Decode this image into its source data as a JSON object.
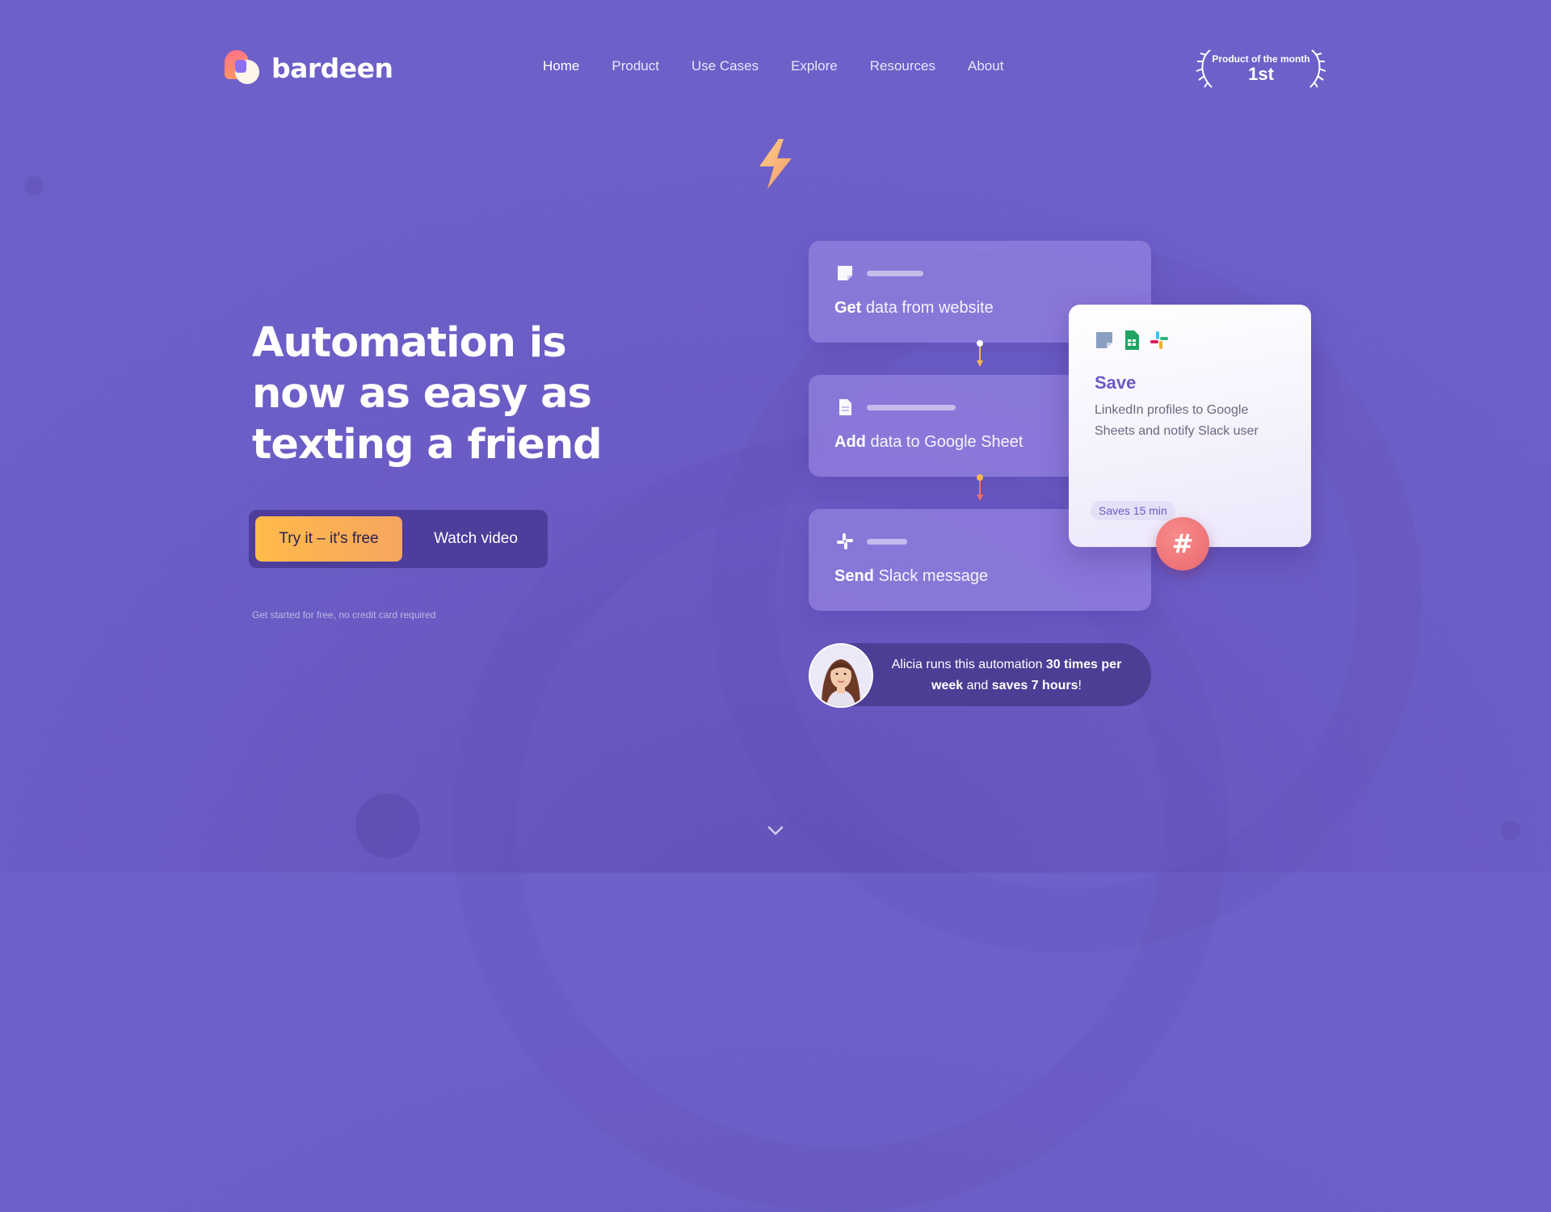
{
  "brand": {
    "name": "bardeen"
  },
  "nav": {
    "items": [
      {
        "label": "Home",
        "active": true
      },
      {
        "label": "Product"
      },
      {
        "label": "Use Cases"
      },
      {
        "label": "Explore"
      },
      {
        "label": "Resources"
      },
      {
        "label": "About"
      }
    ]
  },
  "badge": {
    "line1": "Product of the month",
    "line2": "1st"
  },
  "hero": {
    "headline": "Automation is now as easy as texting a friend",
    "cta_primary": "Try it – it's free",
    "cta_secondary": "Watch video",
    "note": "Get started for free, no credit card required"
  },
  "steps": [
    {
      "verb": "Get",
      "text": " data from website",
      "icon": "note-icon"
    },
    {
      "verb": "Add",
      "text": " data to Google Sheet",
      "icon": "document-icon"
    },
    {
      "verb": "Send",
      "text": " Slack message",
      "icon": "slack-icon"
    }
  ],
  "save_card": {
    "title": "Save",
    "description": "LinkedIn profiles to Google Sheets and notify Slack user",
    "pill": "Saves 15 min",
    "icons": [
      "note-icon",
      "google-sheets-icon",
      "slack-icon"
    ]
  },
  "testimonial": {
    "pre": "Alicia runs this automation ",
    "bold1": "30 times per week",
    "mid": " and ",
    "bold2": "saves 7 hours",
    "post": "!"
  },
  "colors": {
    "background": "#6a5bc4",
    "cta_gradient_start": "#ffba4a",
    "cta_gradient_end": "#f6a65f",
    "accent_purple": "#6a5bc4",
    "hash_badge": "#e8686e"
  }
}
